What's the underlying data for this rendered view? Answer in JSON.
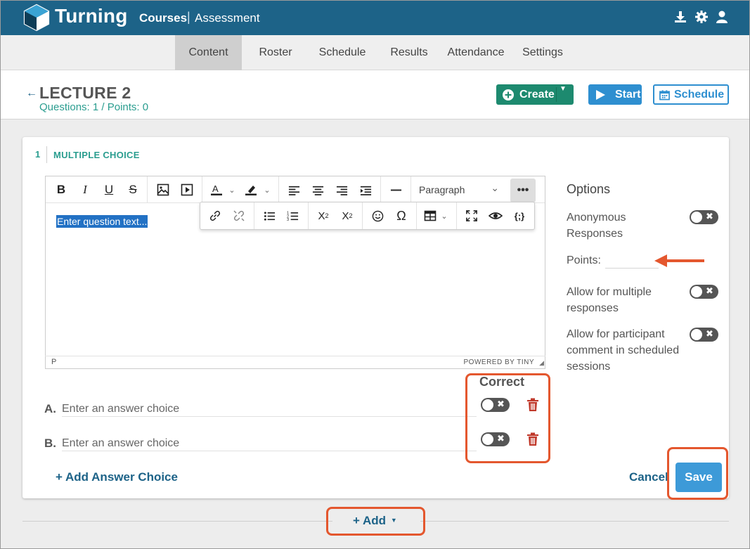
{
  "app": {
    "brand": "Turning",
    "breadcrumb": {
      "courses": "Courses",
      "separator": "|",
      "assessment": "Assessment"
    },
    "top_icons": [
      "download-icon",
      "gear-icon",
      "user-icon"
    ]
  },
  "nav": {
    "tabs": [
      {
        "label": "Content",
        "active": true
      },
      {
        "label": "Roster"
      },
      {
        "label": "Schedule"
      },
      {
        "label": "Results"
      },
      {
        "label": "Attendance"
      },
      {
        "label": "Settings"
      }
    ]
  },
  "header": {
    "back_icon": "back-arrow-icon",
    "title": "LECTURE 2",
    "subtitle": "Questions: 1 / Points: 0",
    "buttons": {
      "create": "Create",
      "start": "Start",
      "schedule": "Schedule"
    }
  },
  "question": {
    "number": "1",
    "type": "MULTIPLE CHOICE",
    "editor": {
      "placeholder": "Enter question text...",
      "paragraph_format": "Paragraph",
      "more": "•••",
      "status_path": "P",
      "powered_by": "POWERED BY TINY",
      "toolbar1_icons": [
        "bold-icon",
        "italic-icon",
        "underline-icon",
        "strikethrough-icon",
        "image-icon",
        "media-icon",
        "text-color-icon",
        "highlight-icon",
        "align-left-icon",
        "align-center-icon",
        "align-right-icon",
        "indent-icon",
        "horizontal-rule-icon"
      ],
      "toolbar2_icons": [
        "link-icon",
        "unlink-icon",
        "bullet-list-icon",
        "numbered-list-icon",
        "subscript-icon",
        "superscript-icon",
        "emoji-icon",
        "special-char-icon",
        "table-icon",
        "fullscreen-icon",
        "preview-icon",
        "code-icon"
      ]
    },
    "answers": {
      "correct_label": "Correct",
      "choices": [
        {
          "letter": "A.",
          "placeholder": "Enter an answer choice",
          "correct": false
        },
        {
          "letter": "B.",
          "placeholder": "Enter an answer choice",
          "correct": false
        }
      ],
      "add_choice": "+ Add Answer Choice"
    },
    "options": {
      "title": "Options",
      "anonymous": "Anonymous Responses",
      "points_label": "Points:",
      "points_value": "",
      "multiple": "Allow for multiple responses",
      "comment": "Allow for participant comment in scheduled sessions",
      "toggles": {
        "anonymous": false,
        "multiple": false,
        "comment": false
      }
    },
    "actions": {
      "cancel": "Cancel",
      "save": "Save"
    }
  },
  "add_button": "+ Add",
  "colors": {
    "topbar": "#1d6388",
    "teal": "#2a9d8f",
    "create_green": "#1d8a6f",
    "start_blue": "#2e8fd0",
    "save_blue": "#3d9ad8",
    "annotation_orange": "#e4572e",
    "trash_red": "#c0392b"
  }
}
